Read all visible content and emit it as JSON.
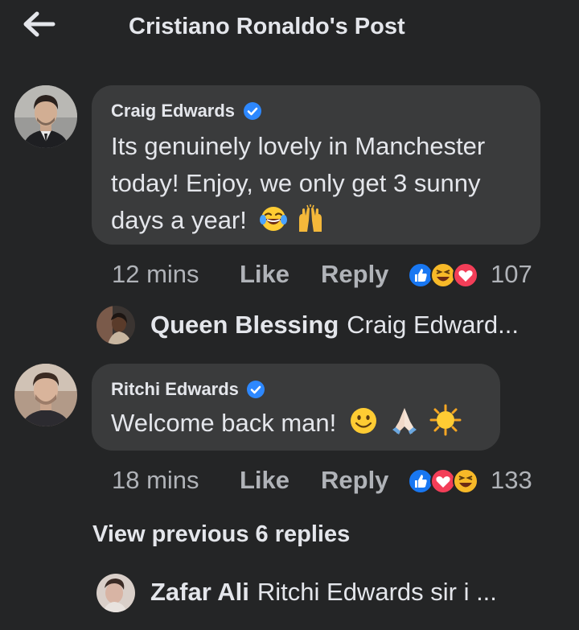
{
  "header": {
    "title": "Cristiano Ronaldo's Post"
  },
  "comments": [
    {
      "author": "Craig Edwards",
      "text_line1": "Its genuinely lovely in Manchester",
      "text_line2": "today! Enjoy, we only get 3 sunny",
      "text_line3": "days a year!",
      "time": "12 mins",
      "like": "Like",
      "reply": "Reply",
      "reaction_count": "107"
    },
    {
      "author": "Ritchi Edwards",
      "text": "Welcome back man!",
      "time": "18 mins",
      "like": "Like",
      "reply": "Reply",
      "reaction_count": "133"
    }
  ],
  "replies": [
    {
      "name": "Queen Blessing",
      "text": "Craig Edward..."
    },
    {
      "name": "Zafar Ali",
      "text": "Ritchi Edwards sir i ..."
    }
  ],
  "view_previous": "View previous 6 replies",
  "colors": {
    "background": "#242526",
    "bubble": "#3a3b3c",
    "meta": "#b0b3b8",
    "verified": "#2d88ff"
  }
}
